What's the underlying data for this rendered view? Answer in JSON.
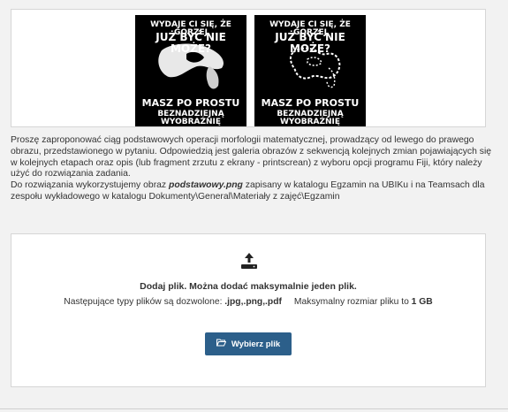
{
  "images": [
    {
      "line1": "WYDAJE CI SIĘ, ŻE GORZEJ",
      "line2": "JUŻ BYĆ NIE MOŻE?",
      "line3": "MASZ PO PROSTU",
      "line4": "BEZNADZIEJNĄ WYOBRAŹNIĘ"
    },
    {
      "line1": "WYDAJE CI SIĘ, ŻE GORZEJ",
      "line2": "JUŻ BYĆ NIE MOŻE?",
      "line3": "MASZ PO PROSTU",
      "line4": "BEZNADZIEJNĄ WYOBRAŹNIĘ"
    }
  ],
  "question": {
    "para1": "Proszę zaproponować ciąg podstawowych operacji morfologii matematycznej, prowadzący od lewego do prawego obrazu, przedstawionego w pytaniu. Odpowiedzią jest galeria obrazów z sekwencją kolejnych zmian pojawiających się w kolejnych etapach oraz opis (lub fragment zrzutu z ekrany - printscrean) z wyboru opcji programu Fiji, który należy użyć do rozwiązania zadania.",
    "para2_prefix": "Do rozwiązania wykorzystujemy obraz ",
    "para2_file": "podstawowy.png",
    "para2_suffix": " zapisany w katalogu Egzamin na UBIKu i na Teamsach dla zespołu wykładowego w katalogu Dokumenty\\General\\Materiały z zajęć\\Egzamin"
  },
  "upload": {
    "title": "Dodaj plik. Można dodać maksymalnie jeden plik.",
    "types_label": "Następujące typy plików są dozwolone: ",
    "types_value": ".jpg,.png,.pdf",
    "max_label": "Maksymalny rozmiar pliku to ",
    "max_value": "1 GB",
    "button_label": "Wybierz plik",
    "button_icon": "folder-open-icon",
    "upload_icon": "upload-icon",
    "button_color": "#2c5f8a"
  }
}
